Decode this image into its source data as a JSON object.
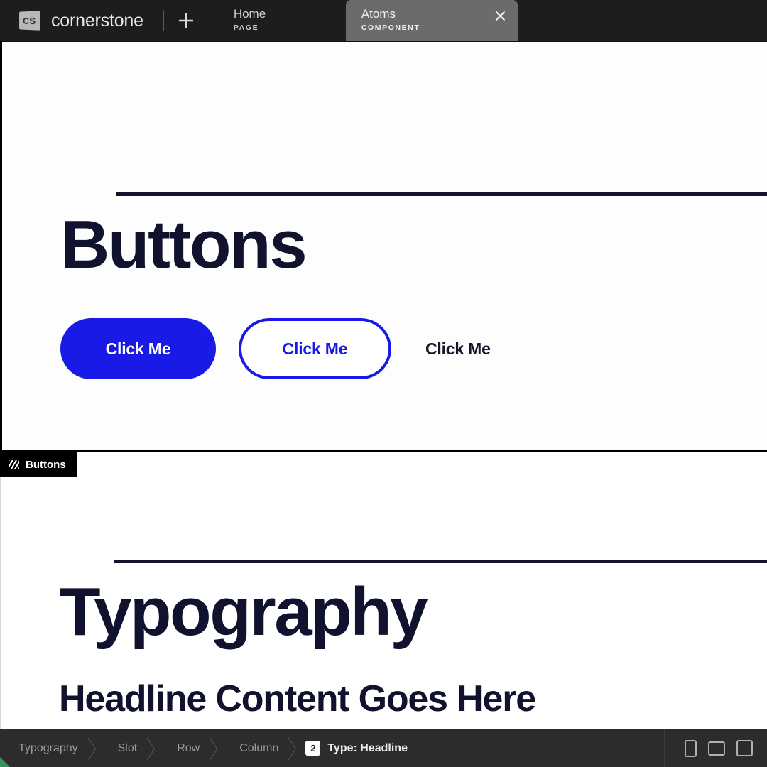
{
  "app": {
    "logo_text": "CS",
    "name": "cornerstone",
    "add_tab_label": "+"
  },
  "tabs": [
    {
      "title": "Home",
      "subtitle": "PAGE",
      "active": false,
      "closable": false
    },
    {
      "title": "Atoms",
      "subtitle": "COMPONENT",
      "active": true,
      "closable": true
    }
  ],
  "canvas": {
    "sections": [
      {
        "id": "buttons",
        "heading": "Buttons",
        "selected": true,
        "selection_label": "Buttons",
        "buttons": [
          {
            "label": "Click Me",
            "variant": "primary"
          },
          {
            "label": "Click Me",
            "variant": "outline"
          },
          {
            "label": "Click Me",
            "variant": "text"
          }
        ]
      },
      {
        "id": "typography",
        "heading": "Typography",
        "subheading": "Headline Content Goes Here",
        "selected": false
      }
    ]
  },
  "statusbar": {
    "breadcrumbs": [
      {
        "label": "Typography",
        "current": false
      },
      {
        "label": "Slot",
        "current": false
      },
      {
        "label": "Row",
        "current": false
      },
      {
        "label": "Column",
        "current": false
      }
    ],
    "current": {
      "badge": "2",
      "label": "Type: Headline"
    },
    "viewports": [
      {
        "name": "mobile-preview"
      },
      {
        "name": "tablet-preview"
      },
      {
        "name": "desktop-preview"
      }
    ]
  },
  "colors": {
    "brand_blue": "#1a1ae6",
    "heading_navy": "#11132e",
    "chrome_dark": "#1d1d1d",
    "statusbar": "#2c2c2c",
    "active_tab": "#6b6b6b"
  }
}
